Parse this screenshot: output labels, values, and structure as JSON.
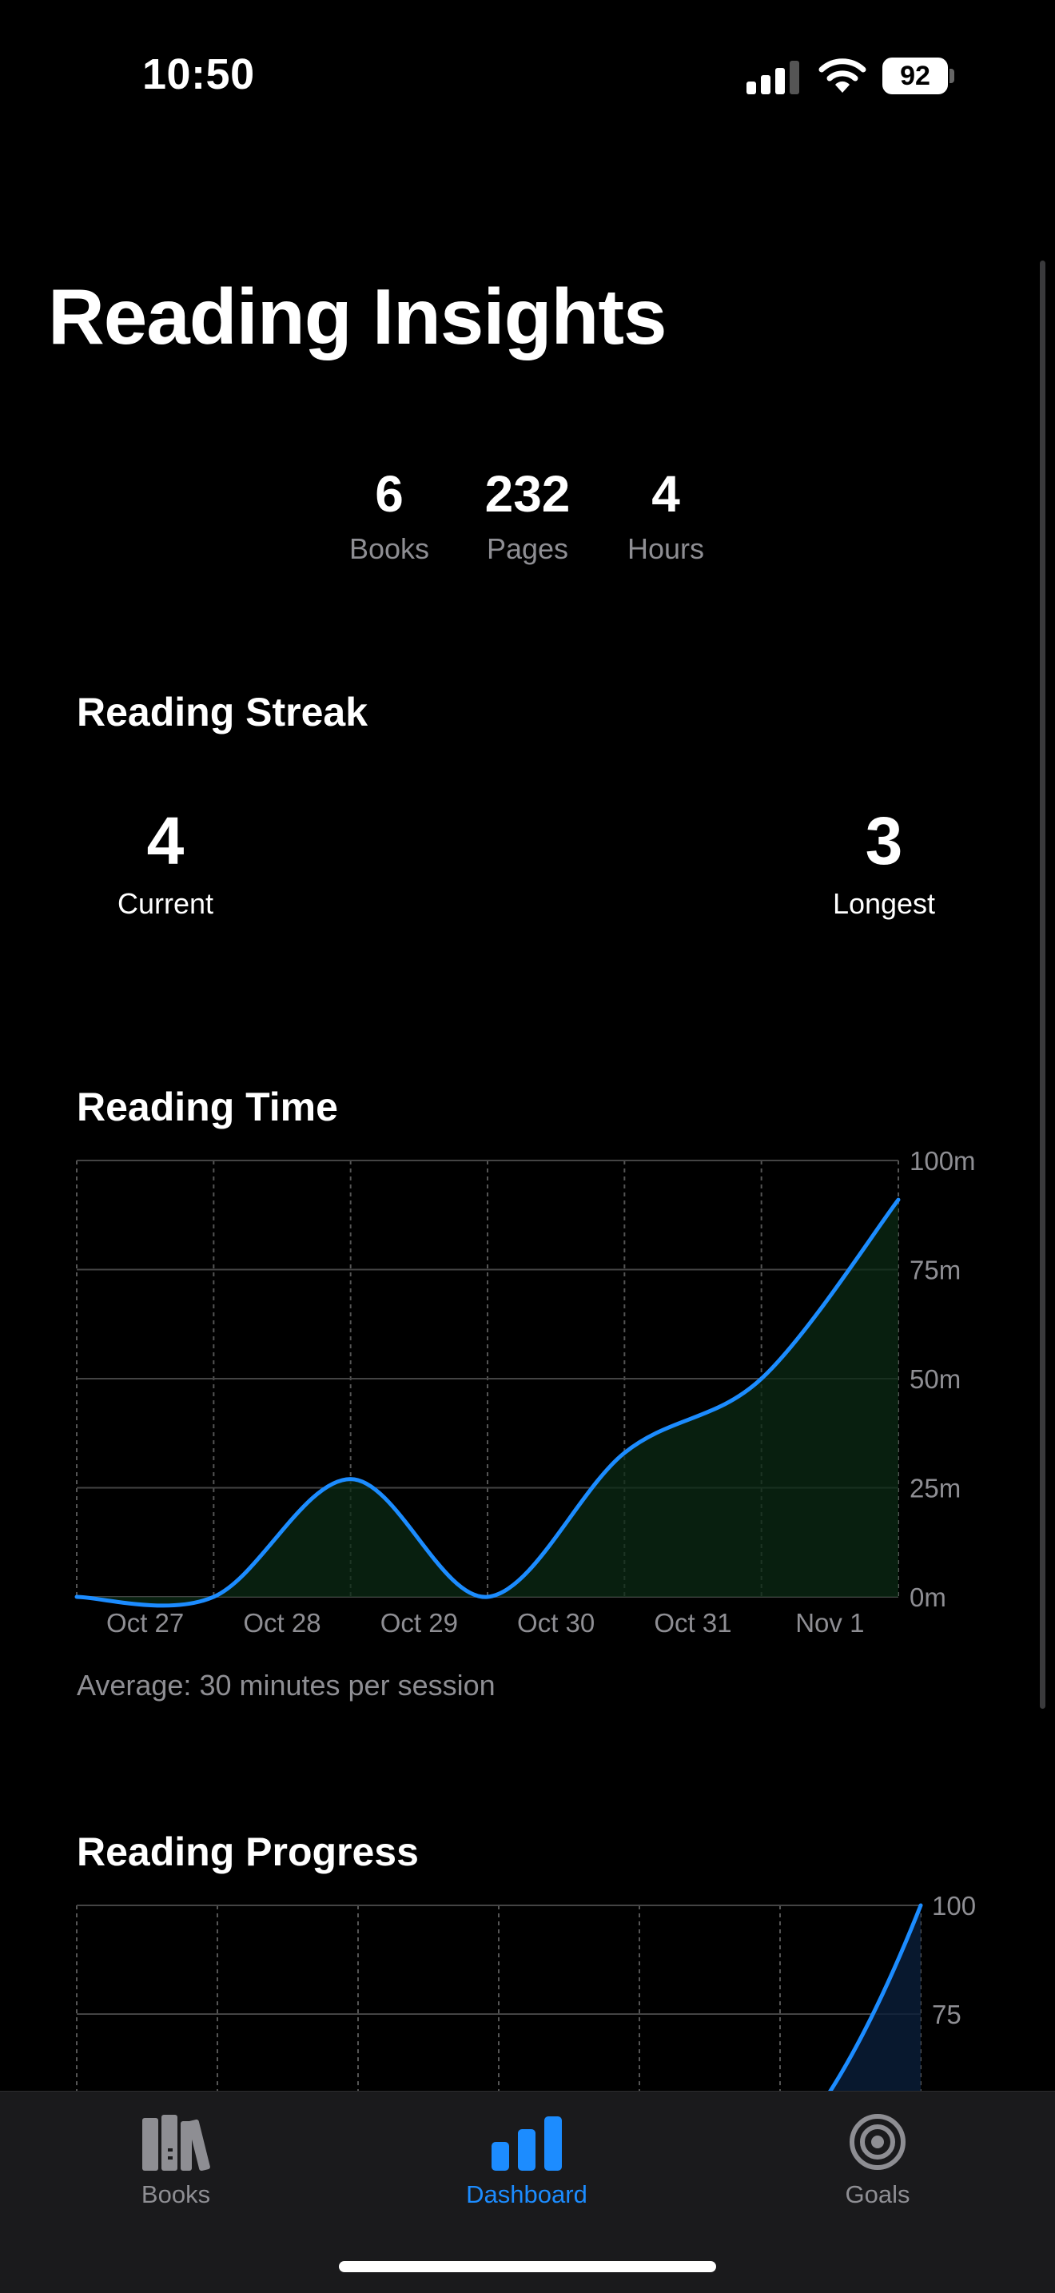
{
  "status_bar": {
    "time": "10:50",
    "battery": "92"
  },
  "page": {
    "title": "Reading Insights"
  },
  "summary": {
    "stats": [
      {
        "value": "6",
        "label": "Books"
      },
      {
        "value": "232",
        "label": "Pages"
      },
      {
        "value": "4",
        "label": "Hours"
      }
    ]
  },
  "streak": {
    "title": "Reading Streak",
    "current": {
      "value": "4",
      "label": "Current"
    },
    "longest": {
      "value": "3",
      "label": "Longest"
    }
  },
  "reading_time": {
    "title": "Reading Time",
    "average_text": "Average: 30 minutes per session"
  },
  "reading_progress": {
    "title": "Reading Progress"
  },
  "tabs": [
    {
      "label": "Books",
      "icon": "books-icon",
      "active": false
    },
    {
      "label": "Dashboard",
      "icon": "chart-bar-icon",
      "active": true
    },
    {
      "label": "Goals",
      "icon": "target-icon",
      "active": false
    }
  ],
  "colors": {
    "accent": "#1c8cff",
    "background": "#000000",
    "tabbar": "#1a1a1c"
  },
  "chart_data": [
    {
      "type": "area",
      "title": "Reading Time",
      "categories": [
        "Oct 27",
        "Oct 28",
        "Oct 29",
        "Oct 30",
        "Oct 31",
        "Nov 1"
      ],
      "values": [
        0,
        0,
        27,
        0,
        33,
        50,
        91
      ],
      "y_ticks": [
        "0m",
        "25m",
        "50m",
        "75m",
        "100m"
      ],
      "ylim": [
        0,
        100
      ],
      "grid": true,
      "color": "#1c8cff"
    },
    {
      "type": "area",
      "title": "Reading Progress",
      "categories": [],
      "values": [
        100
      ],
      "y_ticks": [
        "75",
        "100"
      ],
      "ylim": [
        0,
        100
      ],
      "grid": true,
      "color": "#1c8cff"
    }
  ]
}
